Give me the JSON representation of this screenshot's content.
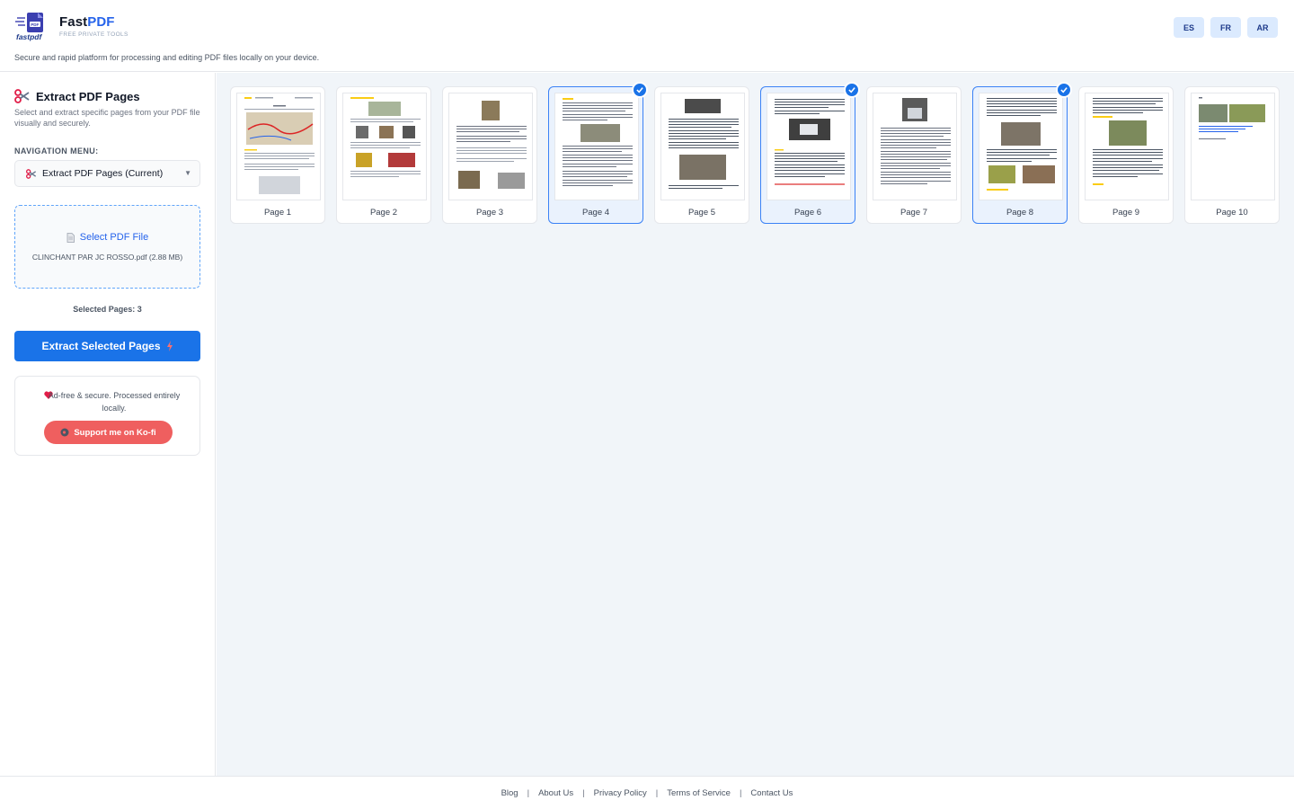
{
  "header": {
    "brand_prefix": "Fast",
    "brand_suffix": "PDF",
    "brand_tagline": "FREE PRIVATE TOOLS",
    "logo_text": "fastpdf",
    "tagline": "Secure and rapid platform for processing and editing PDF files locally on your device.",
    "languages": [
      "ES",
      "FR",
      "AR"
    ]
  },
  "sidebar": {
    "title": "Extract PDF Pages",
    "description": "Select and extract specific pages from your PDF file visually and securely.",
    "nav_label": "NAVIGATION MENU:",
    "nav_selected": "Extract PDF Pages (Current)",
    "select_file_label": "Select PDF File",
    "file_name": "CLINCHANT PAR JC ROSSO.pdf (2.88 MB)",
    "selected_pages_text": "Selected Pages: 3",
    "extract_button": "Extract Selected Pages",
    "info_text": "Ad-free & secure. Processed entirely locally.",
    "kofi_button": "Support me on Ko-fi"
  },
  "pages": [
    {
      "label": "Page 1",
      "selected": false
    },
    {
      "label": "Page 2",
      "selected": false
    },
    {
      "label": "Page 3",
      "selected": false
    },
    {
      "label": "Page 4",
      "selected": true
    },
    {
      "label": "Page 5",
      "selected": false
    },
    {
      "label": "Page 6",
      "selected": true
    },
    {
      "label": "Page 7",
      "selected": false
    },
    {
      "label": "Page 8",
      "selected": true
    },
    {
      "label": "Page 9",
      "selected": false
    },
    {
      "label": "Page 10",
      "selected": false
    }
  ],
  "footer": {
    "links": [
      "Blog",
      "About Us",
      "Privacy Policy",
      "Terms of Service",
      "Contact Us"
    ]
  },
  "colors": {
    "accent": "#1a73e8",
    "brand_blue": "#2563eb",
    "kofi": "#ef5f5f",
    "selected_border": "#3b82f6"
  }
}
